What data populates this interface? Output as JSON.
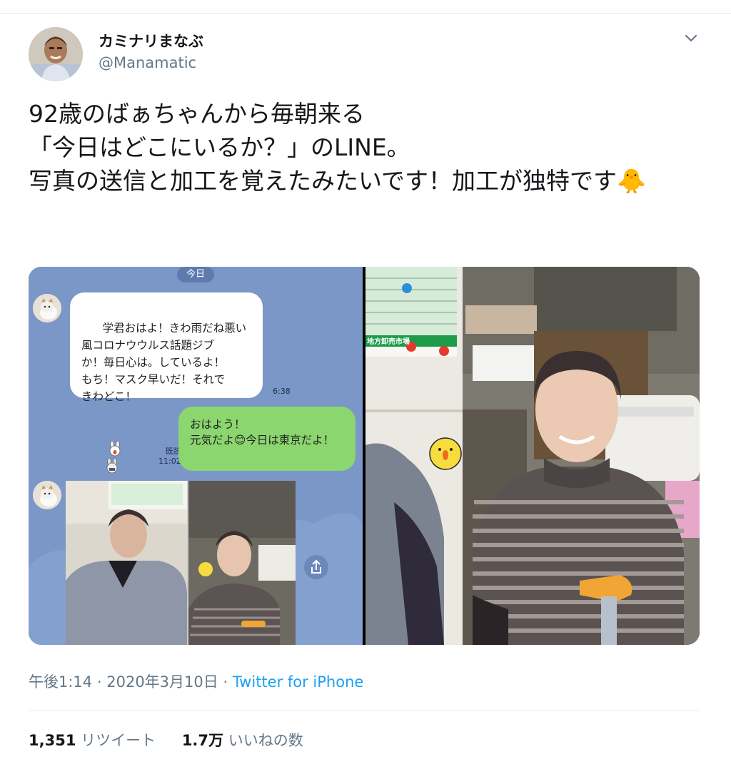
{
  "user": {
    "display_name": "カミナリまなぶ",
    "handle": "@Manamatic"
  },
  "tweet": {
    "text": "92歳のばぁちゃんから毎朝来る\n「今日はどこにいるか？」のLINE。\n写真の送信と加工を覚えたみたいです！加工が独特です🐥"
  },
  "media": {
    "line_chat": {
      "date_label": "今日",
      "incoming_message": "学君おはよ！きわ雨だね悪い\n風コロナウウルス話題ジブ\nか！毎日心は。しているよ！\nもち！マスク早いだ！それで\nきわどこ！",
      "incoming_time": "6:38",
      "outgoing_message": "おはよう！\n元気だよ😊今日は東京だよ！",
      "read_label": "既読",
      "outgoing_time": "11:02"
    },
    "calendar_banner": "地方卸売市場"
  },
  "meta": {
    "time": "午後1:14",
    "separator": "·",
    "date": "2020年3月10日",
    "source": "Twitter for iPhone"
  },
  "stats": {
    "retweets_count": "1,351",
    "retweets_label": "リツイート",
    "likes_count": "1.7万",
    "likes_label": "いいねの数"
  },
  "colors": {
    "text": "#14171a",
    "secondary": "#657786",
    "link": "#1da1f2",
    "line_background": "#7a97c7",
    "line_outgoing": "#8bd66e"
  }
}
